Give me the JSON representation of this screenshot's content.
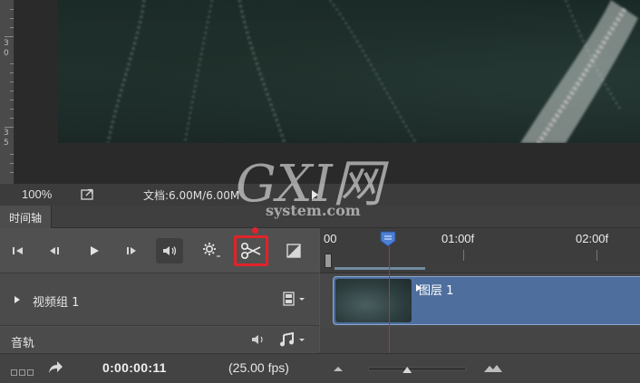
{
  "canvas": {
    "ruler_numbers": [
      "3",
      "0",
      "3",
      "5"
    ]
  },
  "status_bar": {
    "zoom": "100%",
    "doc_size": "文档:6.00M/6.00M"
  },
  "timeline": {
    "tab_label": "时间轴",
    "ruler_labels": [
      "00",
      "01:00f",
      "02:00f"
    ],
    "video_group_label": "视频组 1",
    "clip_label": "图层 1",
    "audio_track_label": "音轨",
    "timecode": "0:00:00:11",
    "fps": "(25.00 fps)",
    "zoom_level": 0.4
  },
  "watermark": {
    "brand": "GXI网",
    "site": "system.com"
  },
  "colors": {
    "highlight": "#e1232a",
    "playhead": "#d9232a",
    "clip": "#4e6f9e"
  },
  "icons": [
    "go-to-first-frame-icon",
    "previous-frame-icon",
    "play-icon",
    "next-frame-icon",
    "audio-icon",
    "settings-gear-icon",
    "scissors-icon",
    "transition-icon",
    "film-strip-icon",
    "speaker-icon",
    "music-note-icon",
    "render-icon",
    "share-arrow-icon"
  ]
}
